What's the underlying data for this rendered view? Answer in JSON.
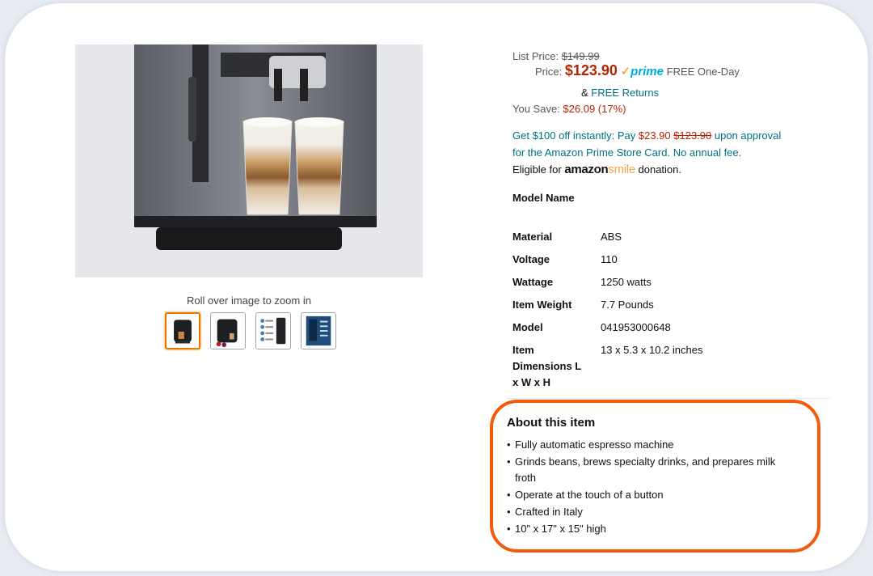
{
  "gallery": {
    "zoom_hint": "Roll over image to zoom in",
    "thumbnails": [
      {
        "name": "front-view",
        "selected": true
      },
      {
        "name": "side-view",
        "selected": false
      },
      {
        "name": "features-chart",
        "selected": false
      },
      {
        "name": "info-panel",
        "selected": false
      }
    ]
  },
  "pricing": {
    "list_price_label": "List Price:",
    "list_price": "$149.99",
    "price_label": "Price:",
    "price": "$123.90",
    "prime_check": "✓",
    "prime": "prime",
    "free_delivery": "FREE One-Day",
    "returns_prefix": "& ",
    "returns_link": "FREE Returns",
    "you_save_label": "You Save:",
    "you_save": "$26.09 (17%)"
  },
  "promo": {
    "line1_prefix": "Get $100 off instantly: Pay ",
    "new_price": "$23.90",
    "old_price": "$123.90",
    "line1_suffix": " upon approval",
    "line2": "for the Amazon Prime Store Card. No annual fee.",
    "eligible_prefix": "Eligible for ",
    "smile_brand": "amazon",
    "smile_word": "smile",
    "eligible_suffix": " donation."
  },
  "specs": {
    "model_name_label": "Model Name",
    "rows": [
      {
        "label": "Material",
        "value": "ABS"
      },
      {
        "label": "Voltage",
        "value": "110"
      },
      {
        "label": "Wattage",
        "value": "1250 watts"
      },
      {
        "label": "Item Weight",
        "value": "7.7 Pounds"
      },
      {
        "label": "Model",
        "value": "041953000648"
      },
      {
        "label_lines": [
          "Item",
          "Dimensions L",
          "x W x H"
        ],
        "value": "13 x 5.3 x 10.2 inches"
      }
    ]
  },
  "about": {
    "title": "About this item",
    "bullets": [
      "Fully automatic espresso machine",
      "Grinds beans, brews specialty drinks, and prepares milk froth",
      "Operate at the touch of a button",
      "Crafted in Italy",
      "10\" x 17\" x 15\" high"
    ]
  },
  "colors": {
    "price_red": "#b12704",
    "link_teal": "#007185",
    "prime_blue": "#00a8e1",
    "highlight_orange": "#f25a0c",
    "thumb_selected": "#e77600"
  }
}
